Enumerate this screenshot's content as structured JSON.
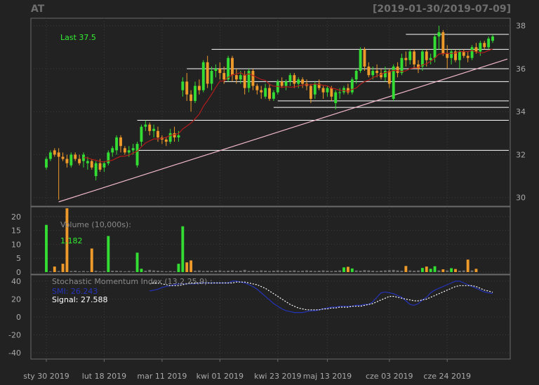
{
  "header": {
    "symbol": "AT",
    "date_range": "[2019-01-30/2019-07-09]"
  },
  "colors": {
    "background": "#222222",
    "panel_border": "#6a6a6a",
    "grid": "#3c3c3c",
    "up": "#33dd33",
    "down": "#ee9a2a",
    "ma_line": "#b01c1c",
    "trend_line": "#f0b8c8",
    "level_line": "#ffffff",
    "label_green": "#33ee33",
    "axis_text": "#aaaaaa",
    "smi_line": "#2433b8",
    "signal_line": "#ffffff"
  },
  "chart_data": {
    "type": "candlestick",
    "title": "",
    "price_axis": {
      "ticks": [
        30,
        32,
        34,
        36,
        38
      ],
      "range": [
        29.6,
        38.35
      ]
    },
    "last_label": "Last 37.5",
    "x_tick_labels": [
      "sty 30 2019",
      "lut 18 2019",
      "mar 11 2019",
      "kwi 01 2019",
      "kwi 23 2019",
      "maj 13 2019",
      "cze 03 2019",
      "cze 24 2019"
    ],
    "x_tick_indices": [
      0,
      14,
      28,
      42,
      56,
      68,
      83,
      97
    ],
    "candles": [
      [
        31.4,
        31.9,
        31.3,
        31.8
      ],
      [
        31.8,
        32.2,
        31.7,
        32.1
      ],
      [
        32.2,
        32.3,
        31.9,
        32.0
      ],
      [
        32.1,
        32.3,
        29.9,
        31.9
      ],
      [
        31.9,
        32.1,
        31.7,
        31.8
      ],
      [
        31.8,
        32.0,
        31.4,
        31.6
      ],
      [
        31.5,
        32.1,
        31.4,
        32.0
      ],
      [
        32.0,
        32.1,
        31.7,
        31.8
      ],
      [
        31.8,
        32.0,
        31.5,
        31.6
      ],
      [
        31.7,
        32.1,
        31.4,
        32.0
      ],
      [
        31.6,
        31.9,
        31.3,
        31.7
      ],
      [
        31.7,
        31.8,
        31.3,
        31.4
      ],
      [
        31.0,
        31.7,
        30.8,
        31.6
      ],
      [
        31.6,
        31.8,
        31.2,
        31.3
      ],
      [
        31.4,
        31.7,
        31.2,
        31.6
      ],
      [
        31.6,
        32.2,
        31.5,
        32.1
      ],
      [
        32.1,
        32.4,
        31.9,
        32.3
      ],
      [
        32.2,
        32.9,
        32.0,
        32.8
      ],
      [
        32.8,
        32.9,
        32.1,
        32.4
      ],
      [
        32.3,
        32.4,
        32.0,
        32.1
      ],
      [
        32.1,
        32.4,
        31.9,
        32.2
      ],
      [
        32.2,
        32.5,
        32.0,
        32.3
      ],
      [
        31.5,
        32.6,
        31.4,
        32.5
      ],
      [
        32.6,
        33.4,
        32.4,
        33.3
      ],
      [
        33.3,
        33.6,
        33.1,
        33.4
      ],
      [
        33.4,
        33.5,
        32.9,
        33.1
      ],
      [
        33.1,
        33.4,
        32.8,
        33.2
      ],
      [
        33.1,
        33.3,
        32.6,
        32.8
      ],
      [
        32.8,
        32.9,
        32.5,
        32.7
      ],
      [
        32.7,
        32.8,
        32.4,
        32.6
      ],
      [
        32.6,
        33.2,
        32.5,
        33.0
      ],
      [
        33.0,
        33.3,
        32.6,
        32.8
      ],
      [
        32.8,
        33.1,
        32.6,
        32.9
      ],
      [
        35.0,
        35.6,
        34.7,
        35.4
      ],
      [
        35.4,
        35.8,
        34.5,
        34.8
      ],
      [
        34.8,
        35.0,
        34.0,
        34.5
      ],
      [
        34.5,
        35.4,
        34.4,
        35.2
      ],
      [
        35.2,
        35.5,
        34.8,
        35.0
      ],
      [
        35.0,
        36.4,
        34.9,
        36.3
      ],
      [
        36.3,
        36.6,
        35.1,
        35.3
      ],
      [
        35.3,
        36.1,
        35.0,
        35.9
      ],
      [
        35.9,
        36.2,
        35.6,
        36.0
      ],
      [
        36.0,
        36.3,
        35.5,
        35.8
      ],
      [
        35.8,
        36.1,
        35.3,
        35.5
      ],
      [
        35.5,
        36.6,
        35.4,
        36.5
      ],
      [
        36.5,
        36.6,
        35.4,
        35.7
      ],
      [
        35.7,
        36.0,
        35.3,
        35.5
      ],
      [
        35.5,
        35.9,
        35.3,
        35.7
      ],
      [
        35.7,
        35.9,
        34.8,
        35.1
      ],
      [
        35.1,
        36.0,
        34.9,
        35.9
      ],
      [
        35.9,
        36.0,
        35.0,
        35.2
      ],
      [
        35.2,
        35.3,
        34.8,
        35.0
      ],
      [
        35.0,
        35.2,
        34.6,
        34.9
      ],
      [
        34.7,
        35.3,
        34.6,
        35.1
      ],
      [
        35.1,
        35.3,
        34.5,
        34.6
      ],
      [
        34.6,
        35.0,
        34.5,
        34.9
      ],
      [
        34.9,
        35.5,
        34.8,
        35.4
      ],
      [
        35.4,
        35.6,
        35.1,
        35.2
      ],
      [
        35.2,
        35.5,
        35.0,
        35.4
      ],
      [
        35.4,
        35.8,
        35.2,
        35.7
      ],
      [
        35.7,
        35.8,
        35.1,
        35.3
      ],
      [
        35.3,
        35.6,
        35.1,
        35.5
      ],
      [
        35.5,
        35.6,
        35.1,
        35.3
      ],
      [
        35.3,
        35.5,
        35.0,
        35.2
      ],
      [
        35.2,
        35.3,
        34.4,
        34.6
      ],
      [
        34.8,
        35.4,
        34.6,
        35.3
      ],
      [
        35.3,
        35.5,
        35.0,
        35.1
      ],
      [
        35.1,
        35.2,
        34.6,
        34.9
      ],
      [
        34.9,
        35.2,
        34.7,
        35.1
      ],
      [
        35.1,
        35.2,
        34.5,
        34.7
      ],
      [
        34.4,
        35.0,
        34.1,
        34.9
      ],
      [
        34.9,
        35.1,
        34.6,
        34.9
      ],
      [
        34.9,
        35.2,
        34.8,
        35.1
      ],
      [
        35.1,
        35.3,
        34.8,
        34.9
      ],
      [
        34.9,
        35.6,
        34.8,
        35.5
      ],
      [
        35.5,
        36.0,
        35.3,
        35.9
      ],
      [
        35.9,
        37.0,
        35.8,
        36.9
      ],
      [
        36.9,
        37.0,
        35.9,
        36.1
      ],
      [
        36.1,
        36.3,
        35.6,
        35.7
      ],
      [
        35.7,
        36.1,
        35.5,
        35.9
      ],
      [
        35.9,
        36.2,
        35.6,
        35.8
      ],
      [
        35.8,
        36.0,
        35.5,
        35.6
      ],
      [
        35.6,
        36.1,
        35.4,
        35.9
      ],
      [
        35.9,
        36.0,
        35.1,
        35.3
      ],
      [
        34.6,
        36.2,
        34.5,
        36.1
      ],
      [
        36.1,
        36.3,
        35.6,
        35.8
      ],
      [
        35.8,
        36.7,
        35.7,
        36.5
      ],
      [
        36.5,
        36.8,
        36.1,
        36.4
      ],
      [
        36.4,
        36.9,
        36.2,
        36.8
      ],
      [
        36.8,
        36.9,
        36.0,
        36.2
      ],
      [
        36.2,
        36.4,
        35.8,
        36.0
      ],
      [
        36.1,
        36.9,
        35.9,
        36.8
      ],
      [
        36.8,
        36.9,
        36.1,
        36.4
      ],
      [
        36.4,
        36.7,
        36.2,
        36.5
      ],
      [
        36.5,
        37.6,
        36.3,
        37.5
      ],
      [
        37.5,
        38.0,
        36.9,
        37.7
      ],
      [
        37.7,
        37.8,
        36.6,
        36.7
      ],
      [
        36.7,
        37.1,
        36.0,
        36.5
      ],
      [
        36.5,
        36.9,
        36.2,
        36.8
      ],
      [
        36.8,
        36.9,
        36.3,
        36.4
      ],
      [
        36.4,
        36.9,
        36.0,
        36.8
      ],
      [
        36.8,
        36.9,
        36.5,
        36.6
      ],
      [
        36.6,
        36.8,
        36.3,
        36.5
      ],
      [
        36.5,
        37.1,
        36.4,
        37.0
      ],
      [
        37.0,
        37.2,
        36.7,
        36.8
      ],
      [
        36.8,
        37.3,
        36.6,
        37.2
      ],
      [
        37.2,
        37.3,
        36.9,
        37.0
      ],
      [
        37.0,
        37.5,
        36.9,
        37.4
      ],
      [
        37.3,
        37.6,
        37.2,
        37.5
      ]
    ],
    "moving_average": {
      "period": 10
    },
    "horizontal_levels": [
      {
        "price": 32.2,
        "from_index": 22
      },
      {
        "price": 33.6,
        "from_index": 22
      },
      {
        "price": 34.2,
        "from_index": 55
      },
      {
        "price": 34.5,
        "from_index": 56
      },
      {
        "price": 35.4,
        "from_index": 43
      },
      {
        "price": 36.0,
        "from_index": 34
      },
      {
        "price": 36.9,
        "from_index": 40
      },
      {
        "price": 37.6,
        "from_index": 87
      }
    ],
    "trend_line": {
      "from": [
        3,
        29.8
      ],
      "to_price_at_right": 36.45
    },
    "volume": {
      "label": "Volume (10,000s):",
      "last_value": "1,182",
      "axis_ticks": [
        0,
        5,
        10,
        15,
        20
      ],
      "range": [
        0,
        23.5
      ],
      "values": [
        17,
        0.3,
        2,
        0.4,
        3,
        23,
        0.4,
        0.5,
        0.3,
        0.4,
        0.3,
        8.5,
        0.5,
        0.3,
        0.4,
        13,
        0.5,
        0.5,
        0.4,
        0.3,
        0.4,
        0.3,
        7,
        1.2,
        0.5,
        0.8,
        0.6,
        0.5,
        0.4,
        0.3,
        0.4,
        0.3,
        3,
        16.5,
        3.5,
        4.2,
        0.5,
        0.6,
        0.4,
        0.5,
        0.4,
        0.5,
        0.6,
        0.4,
        0.5,
        0.6,
        0.4,
        0.5,
        0.8,
        0.4,
        0.5,
        0.4,
        0.6,
        0.5,
        0.4,
        0.5,
        0.6,
        0.5,
        0.4,
        0.5,
        0.6,
        0.4,
        0.5,
        0.6,
        0.5,
        0.4,
        0.5,
        0.6,
        0.5,
        0.4,
        0.5,
        0.6,
        1.7,
        1.9,
        1.3,
        0.6,
        0.5,
        0.7,
        0.6,
        0.5,
        0.4,
        0.5,
        0.6,
        0.7,
        0.8,
        0.6,
        0.5,
        2.2,
        0.6,
        0.5,
        0.6,
        1.5,
        2.0,
        1.2,
        2.1,
        0.6,
        1.0,
        0.6,
        1.4,
        1.1,
        0.5,
        0.6,
        4.5,
        0.6,
        1.18
      ]
    },
    "smi": {
      "label": "Stochastic Momentum Index (13,2,25,9) :",
      "smi_label": "SMI: 26.243",
      "signal_label": "Signal: 27.588",
      "axis_ticks": [
        -40,
        -20,
        0,
        20,
        40
      ],
      "range": [
        -47,
        47
      ],
      "smi_values": [
        null,
        null,
        null,
        null,
        null,
        null,
        null,
        null,
        null,
        null,
        null,
        null,
        null,
        null,
        null,
        null,
        null,
        null,
        null,
        null,
        null,
        null,
        null,
        null,
        null,
        29,
        30,
        31,
        33,
        34,
        35,
        36,
        37,
        37,
        37,
        37,
        37,
        38,
        38,
        38,
        38,
        38,
        38,
        38,
        38,
        40,
        40,
        39,
        38,
        36,
        34,
        31,
        27,
        23,
        19,
        15,
        12,
        9,
        7,
        6,
        5,
        5,
        5,
        6,
        7,
        7,
        8,
        9,
        10,
        11,
        11,
        12,
        12,
        12,
        12,
        13,
        13,
        14,
        14,
        17,
        22,
        27,
        28,
        27,
        26,
        24,
        22,
        18,
        14,
        13,
        15,
        19,
        22,
        27,
        30,
        32,
        34,
        36,
        38,
        40,
        40,
        38,
        36,
        34,
        32,
        30,
        28,
        27,
        26.243
      ],
      "signal_values": [
        null,
        null,
        null,
        null,
        null,
        null,
        null,
        null,
        null,
        null,
        null,
        null,
        null,
        null,
        null,
        null,
        null,
        null,
        null,
        null,
        null,
        null,
        null,
        null,
        null,
        37,
        38,
        38,
        37,
        36,
        35,
        35,
        35,
        36,
        37,
        38,
        38,
        38,
        38,
        38,
        38,
        38,
        38,
        38,
        38,
        38,
        39,
        39,
        39,
        38,
        37,
        36,
        34,
        32,
        29,
        26,
        23,
        20,
        17,
        14,
        12,
        10,
        9,
        8,
        8,
        8,
        8,
        9,
        9,
        10,
        10,
        11,
        11,
        11,
        12,
        12,
        12,
        13,
        14,
        15,
        17,
        19,
        21,
        23,
        23,
        22,
        21,
        20,
        19,
        18,
        18,
        19,
        20,
        22,
        24,
        26,
        28,
        30,
        32,
        34,
        35,
        35,
        35,
        35,
        34,
        32,
        30,
        29,
        27.588
      ]
    }
  }
}
